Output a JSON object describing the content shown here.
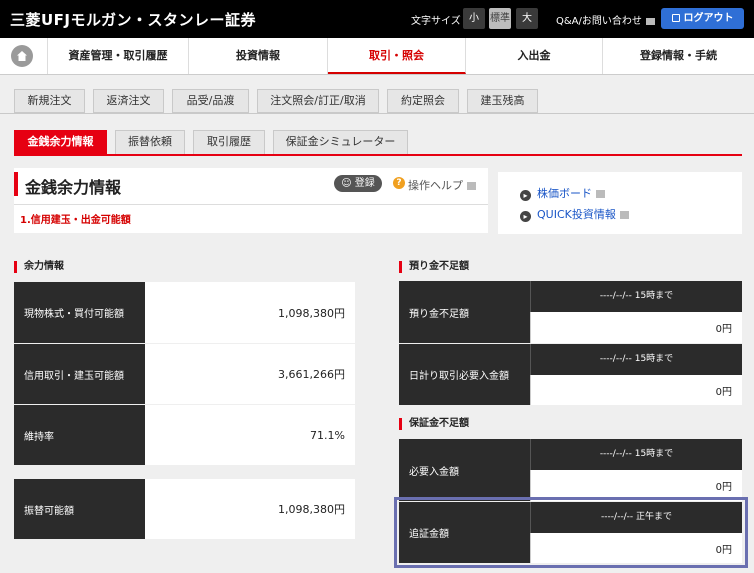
{
  "header": {
    "brand": "三菱UFJモルガン・スタンレー証券",
    "font_size_label": "文字サイズ",
    "font_sizes": [
      "小",
      "標準",
      "大"
    ],
    "font_size_selected": "標準",
    "qa_link": "Q&A/お問い合わせ",
    "logout": "ログアウト"
  },
  "nav": {
    "items": [
      "資産管理・取引履歴",
      "投資情報",
      "取引・照会",
      "入出金",
      "登録情報・手続"
    ],
    "active": "取引・照会"
  },
  "subtabs": [
    "新規注文",
    "返済注文",
    "品受/品渡",
    "注文照会/訂正/取消",
    "約定照会",
    "建玉残高"
  ],
  "tabs2": {
    "items": [
      "金銭余力情報",
      "振替依頼",
      "取引履歴",
      "保証金シミュレーター"
    ],
    "active": "金銭余力情報"
  },
  "title": {
    "text": "金銭余力情報",
    "register": "登録",
    "help": "操作ヘルプ",
    "subsection": "1.信用建玉・出金可能額"
  },
  "links": [
    "株価ボード",
    "QUICK投資情報"
  ],
  "left": {
    "heading": "余力情報",
    "rows": [
      {
        "label": "現物株式・買付可能額",
        "value": "1,098,380円"
      },
      {
        "label": "信用取引・建玉可能額",
        "value": "3,661,266円"
      },
      {
        "label": "維持率",
        "value": "71.1%"
      },
      {
        "label": "振替可能額",
        "value": "1,098,380円"
      }
    ]
  },
  "right": {
    "shortfall_heading": "預り金不足額",
    "shortfall_rows": [
      {
        "label": "預り金不足額",
        "date": "----/--/-- 15時まで",
        "value": "0円"
      },
      {
        "label": "日計り取引必要入金額",
        "date": "----/--/-- 15時まで",
        "value": "0円"
      }
    ],
    "margin_heading": "保証金不足額",
    "margin_rows": [
      {
        "label": "必要入金額",
        "date": "----/--/-- 15時まで",
        "value": "0円"
      },
      {
        "label": "追証金額",
        "date": "----/--/-- 正午まで",
        "value": "0円"
      }
    ]
  },
  "colors": {
    "accent_red": "#e60012",
    "logout_blue": "#2f6fd6",
    "highlight": "#6a6fb0"
  }
}
